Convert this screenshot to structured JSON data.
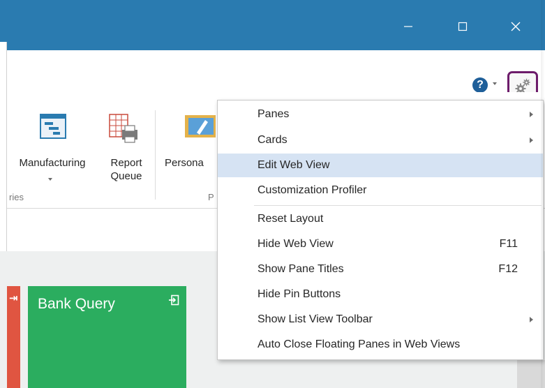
{
  "window": {
    "minimize_glyph": "—",
    "maximize_glyph": "☐",
    "close_glyph": "✕",
    "title_bar_color": "#2a7bb0"
  },
  "header": {
    "help_icon_glyph": "?",
    "settings_icon": "gears-icon"
  },
  "ribbon": {
    "items": [
      {
        "label": "Manufacturing",
        "icon": "manufacturing-icon"
      },
      {
        "label": "Report\nQueue",
        "icon": "report-queue-icon"
      },
      {
        "label": "Persona",
        "icon": "personalize-icon"
      }
    ],
    "group_labels": [
      "ries",
      "P"
    ]
  },
  "tiles": [
    {
      "title": "Bank Query",
      "color": "#2bad5f"
    },
    {
      "title": "",
      "color": "#e05541"
    }
  ],
  "menu": {
    "items": [
      {
        "label": "Panes",
        "shortcut": "",
        "submenu": true
      },
      {
        "label": "Cards",
        "shortcut": "",
        "submenu": true
      },
      {
        "label": "Edit Web View",
        "shortcut": "",
        "submenu": false,
        "highlighted": true
      },
      {
        "label": "Customization Profiler",
        "shortcut": "",
        "submenu": false
      },
      {
        "label": "Reset Layout",
        "shortcut": "",
        "submenu": false
      },
      {
        "label": "Hide Web View",
        "shortcut": "F11",
        "submenu": false
      },
      {
        "label": "Show Pane Titles",
        "shortcut": "F12",
        "submenu": false
      },
      {
        "label": "Hide Pin Buttons",
        "shortcut": "",
        "submenu": false
      },
      {
        "label": "Show List View Toolbar",
        "shortcut": "",
        "submenu": true
      },
      {
        "label": "Auto Close Floating Panes in Web Views",
        "shortcut": "",
        "submenu": false
      }
    ]
  }
}
